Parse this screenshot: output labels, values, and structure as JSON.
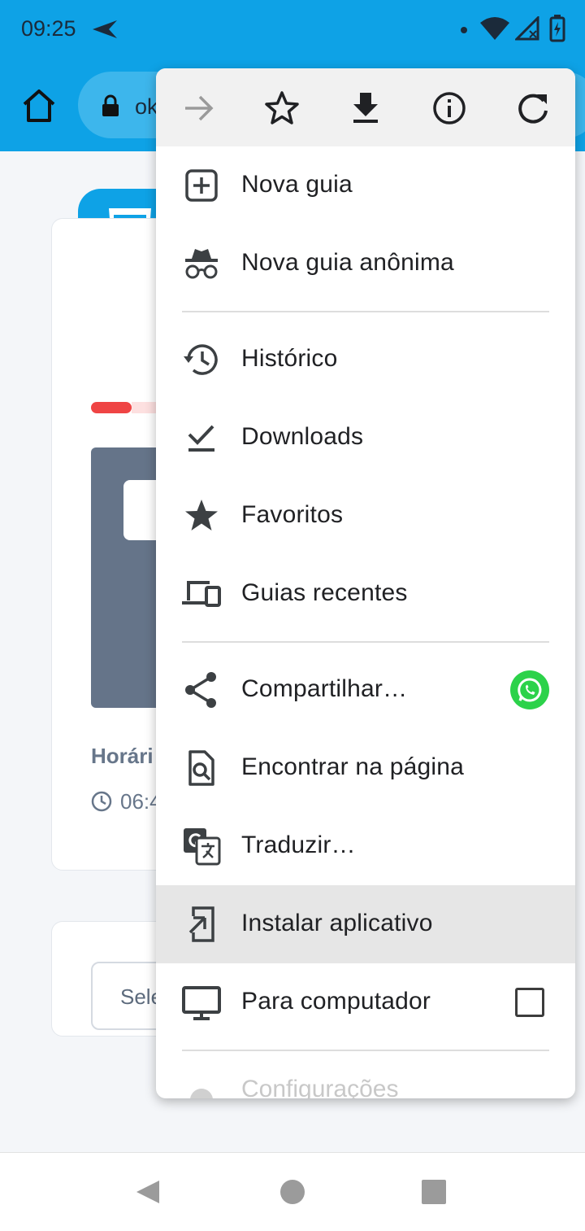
{
  "status_bar": {
    "time": "09:25"
  },
  "browser": {
    "url_fragment": "ok"
  },
  "page": {
    "horario_label": "Horári",
    "time_value": "06:4",
    "day_select_placeholder": "Selecione um dia"
  },
  "menu": {
    "toolbar_icons": [
      "forward-icon",
      "bookmark-star-icon",
      "download-icon",
      "info-icon",
      "reload-icon"
    ],
    "items": [
      {
        "label": "Nova guia",
        "icon": "add-box-icon"
      },
      {
        "label": "Nova guia anônima",
        "icon": "incognito-icon"
      },
      {
        "label": "Histórico",
        "icon": "history-icon"
      },
      {
        "label": "Downloads",
        "icon": "download-done-icon"
      },
      {
        "label": "Favoritos",
        "icon": "star-icon"
      },
      {
        "label": "Guias recentes",
        "icon": "devices-icon"
      },
      {
        "label": "Compartilhar…",
        "icon": "share-icon"
      },
      {
        "label": "Encontrar na página",
        "icon": "find-in-page-icon"
      },
      {
        "label": "Traduzir…",
        "icon": "translate-icon"
      },
      {
        "label": "Instalar aplicativo",
        "icon": "install-app-icon",
        "highlighted": true
      },
      {
        "label": "Para computador",
        "icon": "desktop-icon",
        "checked": false
      },
      {
        "label": "Configurações",
        "icon": "settings-icon"
      }
    ]
  },
  "colors": {
    "accent": "#0ea2e6",
    "highlight": "#e6e6e6",
    "whatsapp": "#2cd24a",
    "progress": "#ef4444"
  }
}
